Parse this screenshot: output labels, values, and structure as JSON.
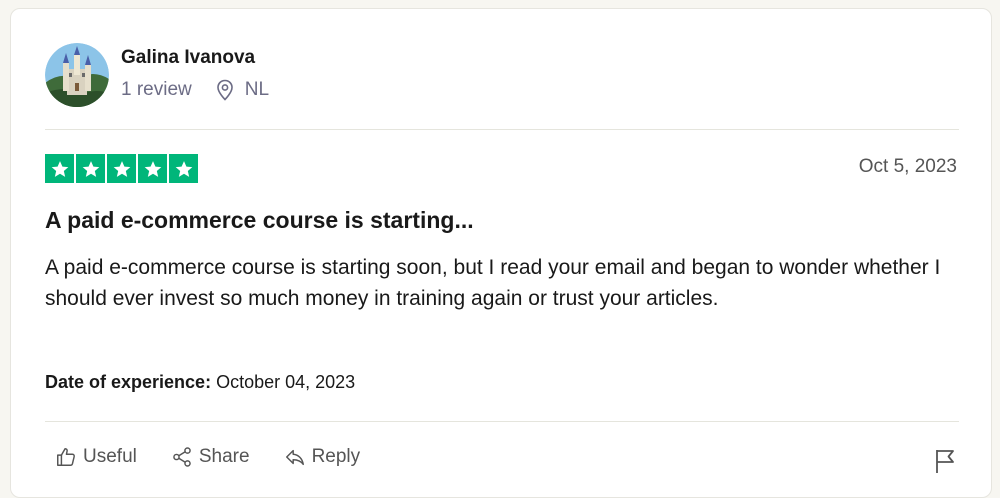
{
  "reviewer": {
    "name": "Galina Ivanova",
    "review_count": "1 review",
    "country": "NL"
  },
  "review": {
    "rating": 5,
    "date": "Oct 5, 2023",
    "title": "A paid e-commerce course is starting...",
    "body": "A paid e-commerce course is starting soon, but I read your email and began to wonder whether I should ever invest so much money in training again or trust your articles.",
    "experience_label": "Date of experience:",
    "experience_date": "October 04, 2023"
  },
  "actions": {
    "useful": "Useful",
    "share": "Share",
    "reply": "Reply"
  },
  "colors": {
    "star_green": "#00b67a",
    "muted_text": "#6c6c85"
  },
  "icons": [
    "location-pin-icon",
    "thumbs-up-icon",
    "share-icon",
    "reply-icon",
    "flag-icon",
    "star-icon"
  ]
}
